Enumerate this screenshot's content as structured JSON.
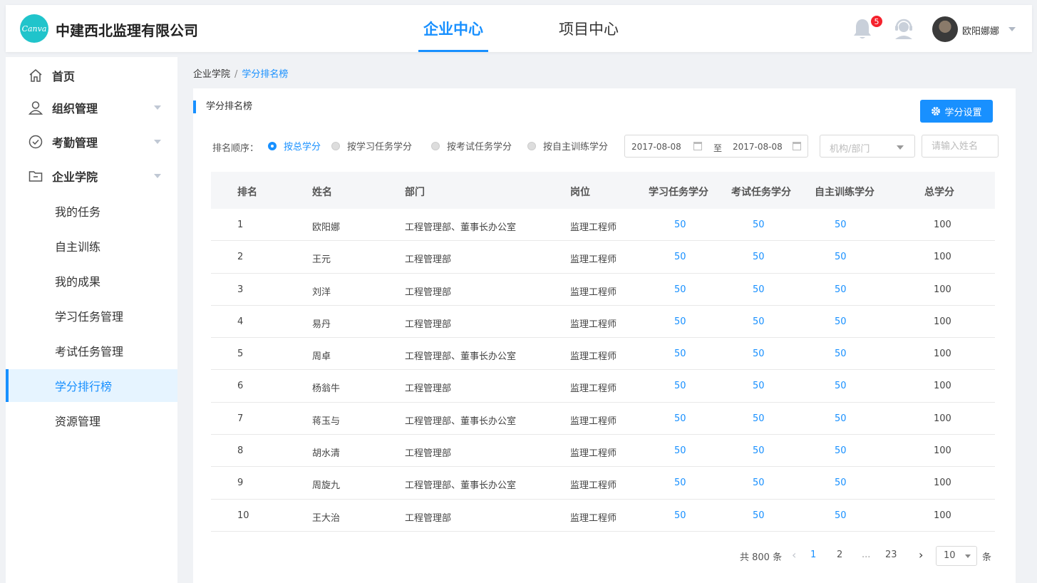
{
  "header": {
    "logo_text": "Canva",
    "company": "中建西北监理有限公司",
    "tabs": [
      {
        "label": "企业中心",
        "active": true
      },
      {
        "label": "项目中心",
        "active": false
      }
    ],
    "notification_count": "5",
    "username": "欧阳娜娜"
  },
  "sidebar": {
    "menu": [
      {
        "label": "首页",
        "icon": "home-icon"
      },
      {
        "label": "组织管理",
        "icon": "user-icon"
      },
      {
        "label": "考勤管理",
        "icon": "check-circle-icon"
      },
      {
        "label": "企业学院",
        "icon": "folder-icon"
      }
    ],
    "sub_items": [
      {
        "label": "我的任务"
      },
      {
        "label": "自主训练"
      },
      {
        "label": "我的成果"
      },
      {
        "label": "学习任务管理"
      },
      {
        "label": "考试任务管理"
      },
      {
        "label": "学分排行榜",
        "active": true
      },
      {
        "label": "资源管理"
      }
    ]
  },
  "breadcrumb": {
    "parent": "企业学院",
    "separator": "/",
    "current": "学分排名榜"
  },
  "card": {
    "title": "学分排名榜",
    "settings_button": "学分设置"
  },
  "filter": {
    "label": "排名顺序：",
    "options": [
      {
        "label": "按总学分",
        "checked": true
      },
      {
        "label": "按学习任务学分",
        "checked": false
      },
      {
        "label": "按考试任务学分",
        "checked": false
      },
      {
        "label": "按自主训练学分",
        "checked": false
      }
    ],
    "date_start": "2017-08-08",
    "date_sep": "至",
    "date_end": "2017-08-08",
    "dept_placeholder": "机构/部门",
    "name_placeholder": "请输入姓名"
  },
  "table": {
    "columns": [
      "排名",
      "姓名",
      "部门",
      "岗位",
      "学习任务学分",
      "考试任务学分",
      "自主训练学分",
      "总学分"
    ],
    "rows": [
      [
        "1",
        "欧阳娜",
        "工程管理部、董事长办公室",
        "监理工程师",
        "50",
        "50",
        "50",
        "100"
      ],
      [
        "2",
        "王元",
        "工程管理部",
        "监理工程师",
        "50",
        "50",
        "50",
        "100"
      ],
      [
        "3",
        "刘洋",
        "工程管理部",
        "监理工程师",
        "50",
        "50",
        "50",
        "100"
      ],
      [
        "4",
        "易丹",
        "工程管理部",
        "监理工程师",
        "50",
        "50",
        "50",
        "100"
      ],
      [
        "5",
        "周卓",
        "工程管理部、董事长办公室",
        "监理工程师",
        "50",
        "50",
        "50",
        "100"
      ],
      [
        "6",
        "杨翁牛",
        "工程管理部",
        "监理工程师",
        "50",
        "50",
        "50",
        "100"
      ],
      [
        "7",
        "蒋玉与",
        "工程管理部、董事长办公室",
        "监理工程师",
        "50",
        "50",
        "50",
        "100"
      ],
      [
        "8",
        "胡水清",
        "工程管理部",
        "监理工程师",
        "50",
        "50",
        "50",
        "100"
      ],
      [
        "9",
        "周旋九",
        "工程管理部、董事长办公室",
        "监理工程师",
        "50",
        "50",
        "50",
        "100"
      ],
      [
        "10",
        "王大治",
        "工程管理部",
        "监理工程师",
        "50",
        "50",
        "50",
        "100"
      ]
    ]
  },
  "pagination": {
    "total": "共 800 条",
    "pages": [
      "1",
      "2",
      "...",
      "23"
    ],
    "current": "1",
    "page_size": "10",
    "unit": "条"
  },
  "colors": {
    "primary": "#1890ff",
    "logo": "#20c4cb",
    "badge": "#f5222d"
  }
}
